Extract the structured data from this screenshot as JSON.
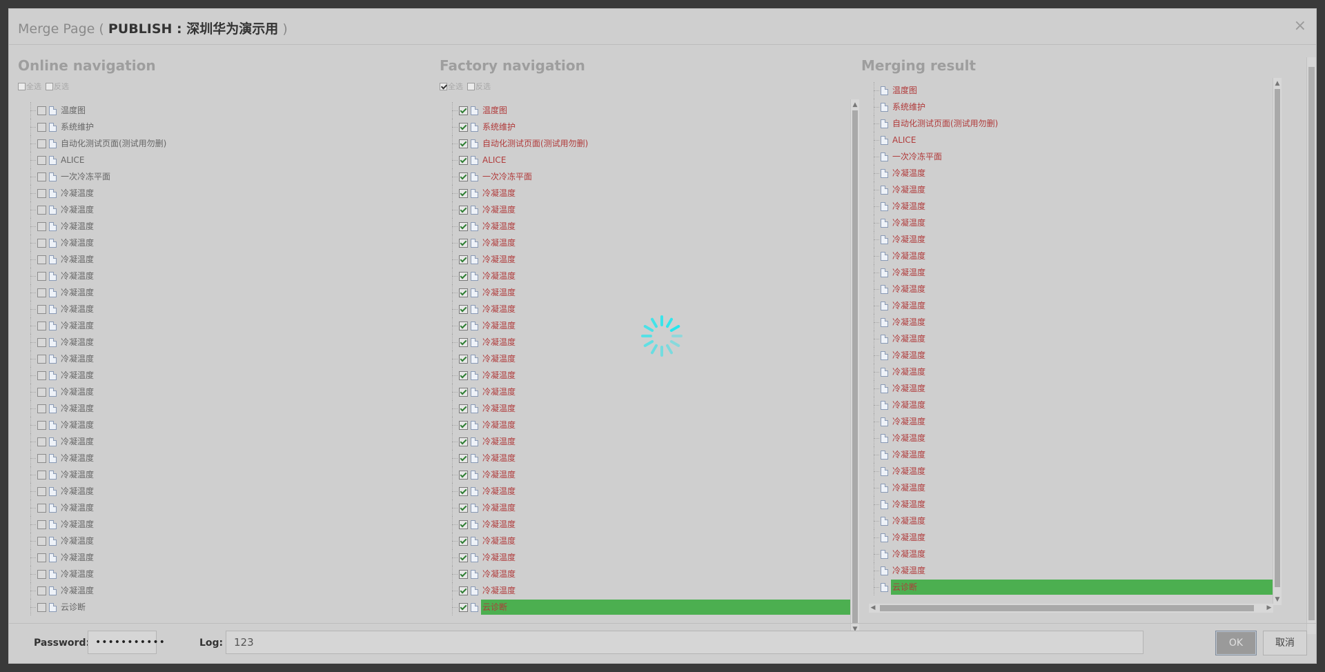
{
  "dialog": {
    "title_prefix": "Merge Page ( ",
    "title_bold": "PUBLISH : 深圳华为演示用",
    "title_suffix": " )",
    "close": "×"
  },
  "online": {
    "title": "Online navigation",
    "select_all": "全选",
    "invert": "反选",
    "items": [
      "温度图",
      "系统维护",
      "自动化测试页面(测试用勿删)",
      "ALICE",
      "一次冷冻平面",
      "冷凝温度",
      "冷凝温度",
      "冷凝温度",
      "冷凝温度",
      "冷凝温度",
      "冷凝温度",
      "冷凝温度",
      "冷凝温度",
      "冷凝温度",
      "冷凝温度",
      "冷凝温度",
      "冷凝温度",
      "冷凝温度",
      "冷凝温度",
      "冷凝温度",
      "冷凝温度",
      "冷凝温度",
      "冷凝温度",
      "冷凝温度",
      "冷凝温度",
      "冷凝温度",
      "冷凝温度",
      "冷凝温度",
      "冷凝温度",
      "冷凝温度",
      "云诊断"
    ]
  },
  "factory": {
    "title": "Factory navigation",
    "select_all": "全选",
    "invert": "反选",
    "items": [
      "温度图",
      "系统维护",
      "自动化测试页面(测试用勿删)",
      "ALICE",
      "一次冷冻平面",
      "冷凝温度",
      "冷凝温度",
      "冷凝温度",
      "冷凝温度",
      "冷凝温度",
      "冷凝温度",
      "冷凝温度",
      "冷凝温度",
      "冷凝温度",
      "冷凝温度",
      "冷凝温度",
      "冷凝温度",
      "冷凝温度",
      "冷凝温度",
      "冷凝温度",
      "冷凝温度",
      "冷凝温度",
      "冷凝温度",
      "冷凝温度",
      "冷凝温度",
      "冷凝温度",
      "冷凝温度",
      "冷凝温度",
      "冷凝温度",
      "冷凝温度",
      "云诊断"
    ],
    "selected_index": 30
  },
  "result": {
    "title": "Merging result",
    "items": [
      "温度图",
      "系统维护",
      "自动化测试页面(测试用勿删)",
      "ALICE",
      "一次冷冻平面",
      "冷凝温度",
      "冷凝温度",
      "冷凝温度",
      "冷凝温度",
      "冷凝温度",
      "冷凝温度",
      "冷凝温度",
      "冷凝温度",
      "冷凝温度",
      "冷凝温度",
      "冷凝温度",
      "冷凝温度",
      "冷凝温度",
      "冷凝温度",
      "冷凝温度",
      "冷凝温度",
      "冷凝温度",
      "冷凝温度",
      "冷凝温度",
      "冷凝温度",
      "冷凝温度",
      "冷凝温度",
      "冷凝温度",
      "冷凝温度",
      "冷凝温度",
      "云诊断"
    ],
    "selected_index": 30
  },
  "footer": {
    "password_label": "Password:",
    "password_value": "•••••••••••",
    "log_label": "Log:",
    "log_value": "123",
    "ok_label": "OK",
    "cancel_label": "取消"
  },
  "colors": {
    "selected": "#4caf50",
    "factory_text": "#b03a3a",
    "spinner": "#1de9f0"
  }
}
